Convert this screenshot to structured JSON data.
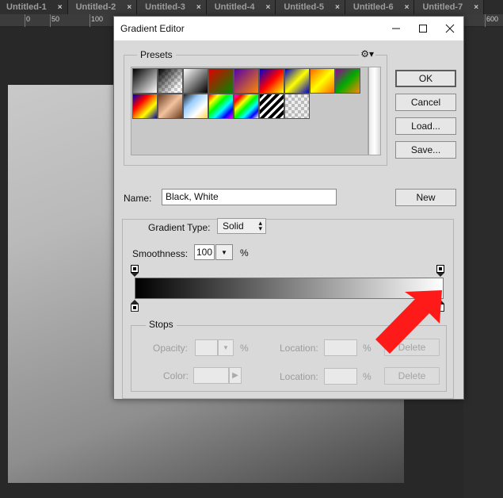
{
  "tabs": [
    {
      "label": "Untitled-1"
    },
    {
      "label": "Untitled-2"
    },
    {
      "label": "Untitled-3"
    },
    {
      "label": "Untitled-4"
    },
    {
      "label": "Untitled-5"
    },
    {
      "label": "Untitled-6"
    },
    {
      "label": "Untitled-7"
    }
  ],
  "tab_close": "×",
  "ruler": {
    "labels": [
      "0",
      "50",
      "100",
      "600"
    ]
  },
  "dialog": {
    "title": "Gradient Editor",
    "presets_label": "Presets",
    "gear": "⚙▾",
    "buttons": {
      "ok": "OK",
      "cancel": "Cancel",
      "load": "Load...",
      "save": "Save...",
      "new": "New"
    },
    "name_label": "Name:",
    "name_value": "Black, White",
    "gradient_type_label": "Gradient Type:",
    "gradient_type_value": "Solid",
    "smoothness_label": "Smoothness:",
    "smoothness_value": "100",
    "smoothness_unit": "%",
    "stops": {
      "label": "Stops",
      "opacity_label": "Opacity:",
      "opacity_unit": "%",
      "location_label": "Location:",
      "location_unit": "%",
      "color_label": "Color:",
      "delete_label": "Delete"
    }
  },
  "colors": {
    "accent_arrow": "#ff1a1a",
    "gradient_start": "#000000",
    "gradient_end": "#ffffff"
  }
}
